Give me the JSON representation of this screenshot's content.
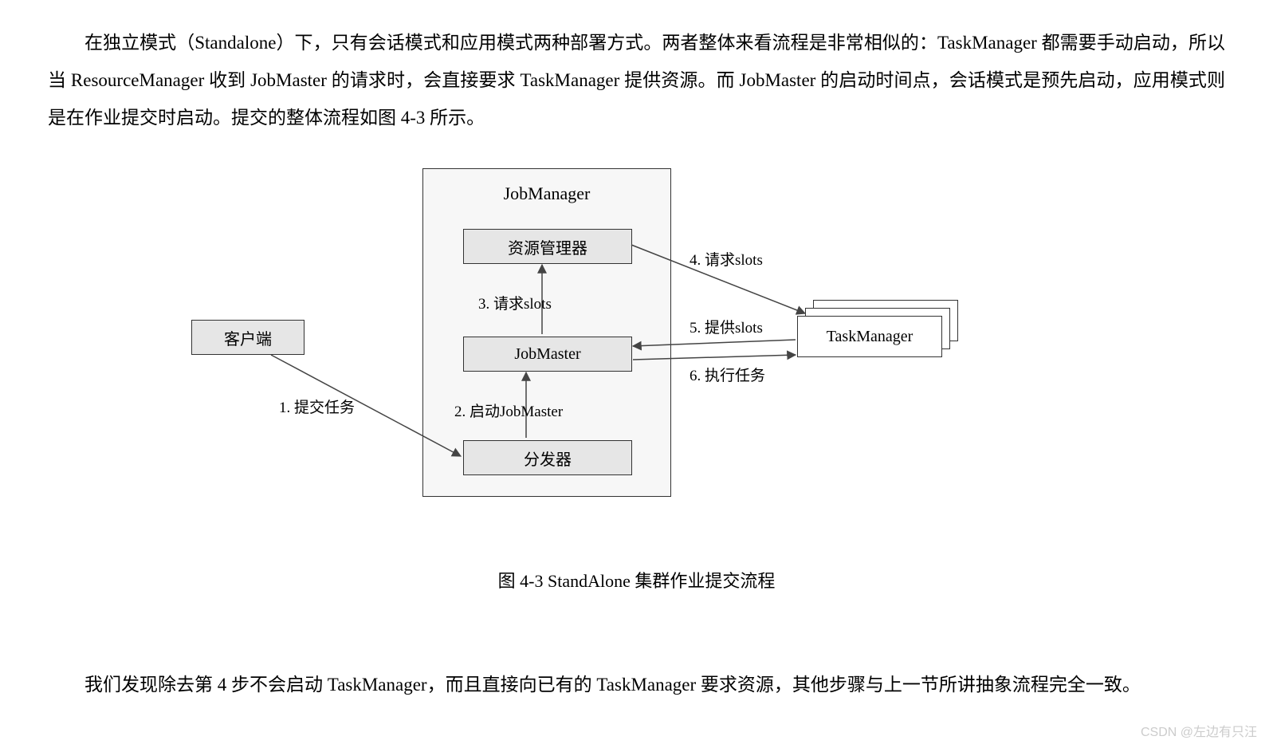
{
  "paragraph1": "在独立模式（Standalone）下，只有会话模式和应用模式两种部署方式。两者整体来看流程是非常相似的：TaskManager 都需要手动启动，所以当 ResourceManager 收到 JobMaster 的请求时，会直接要求 TaskManager 提供资源。而 JobMaster 的启动时间点，会话模式是预先启动，应用模式则是在作业提交时启动。提交的整体流程如图 4-3 所示。",
  "figure": {
    "client": "客户端",
    "job_manager_title": "JobManager",
    "resource_manager": "资源管理器",
    "job_master": "JobMaster",
    "dispatcher": "分发器",
    "task_manager": "TaskManager",
    "edge1": "1. 提交任务",
    "edge2": "2. 启动JobMaster",
    "edge3": "3. 请求slots",
    "edge4": "4. 请求slots",
    "edge5": "5. 提供slots",
    "edge6": "6. 执行任务"
  },
  "caption": "图 4-3 StandAlone 集群作业提交流程",
  "paragraph2": "我们发现除去第 4 步不会启动 TaskManager，而且直接向已有的 TaskManager 要求资源，其他步骤与上一节所讲抽象流程完全一致。",
  "watermark": "CSDN @左边有只汪"
}
